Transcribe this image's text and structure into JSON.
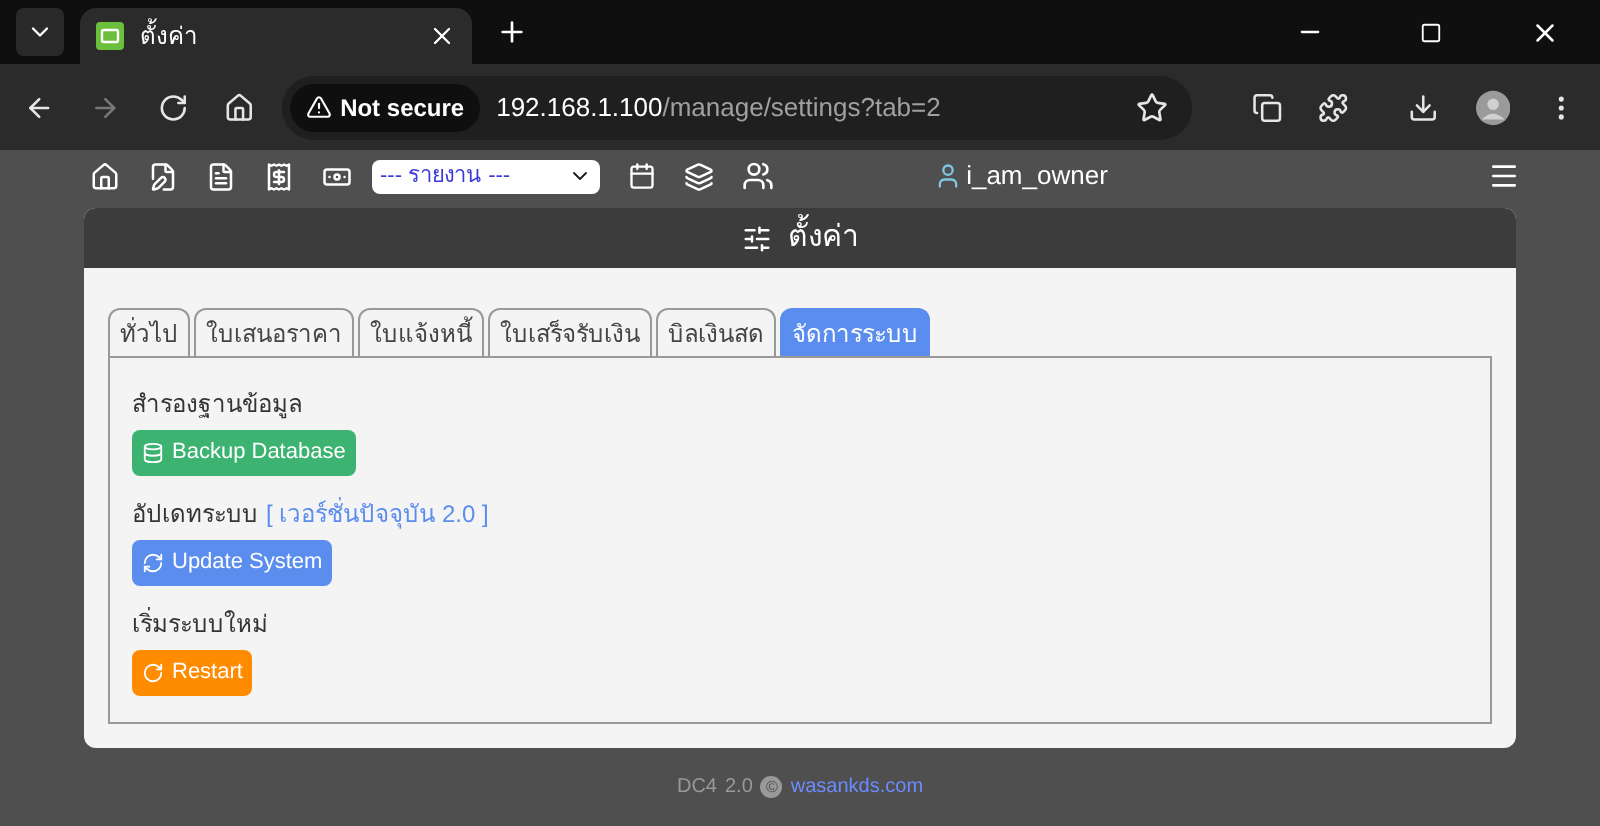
{
  "browser": {
    "tab_title": "ตั้งค่า",
    "security": "Not secure",
    "url_host": "192.168.1.100",
    "url_path": "/manage/settings?tab=2"
  },
  "navbar": {
    "report_select": "--- รายงาน ---",
    "user": "i_am_owner"
  },
  "card": {
    "title": "ตั้งค่า"
  },
  "tabs": [
    {
      "label": "ทั่วไป",
      "selected": false
    },
    {
      "label": "ใบเสนอราคา",
      "selected": false
    },
    {
      "label": "ใบแจ้งหนี้",
      "selected": false
    },
    {
      "label": "ใบเสร็จรับเงิน",
      "selected": false
    },
    {
      "label": "บิลเงินสด",
      "selected": false
    },
    {
      "label": "จัดการระบบ",
      "selected": true
    }
  ],
  "sections": [
    {
      "title": "สำรองฐานข้อมูล",
      "button": {
        "kind": "backup",
        "label": "Backup Database"
      }
    },
    {
      "title": "อัปเดทระบบ",
      "note": "[ เวอร์ชั่นปัจจุบัน 2.0 ]",
      "button": {
        "kind": "update",
        "label": "Update System"
      }
    },
    {
      "title": "เริ่มระบบใหม่",
      "button": {
        "kind": "restart",
        "label": "Restart"
      }
    }
  ],
  "footer": {
    "app": "DC4",
    "version": "2.0",
    "copyright": "©",
    "link": "wasankds.com"
  }
}
